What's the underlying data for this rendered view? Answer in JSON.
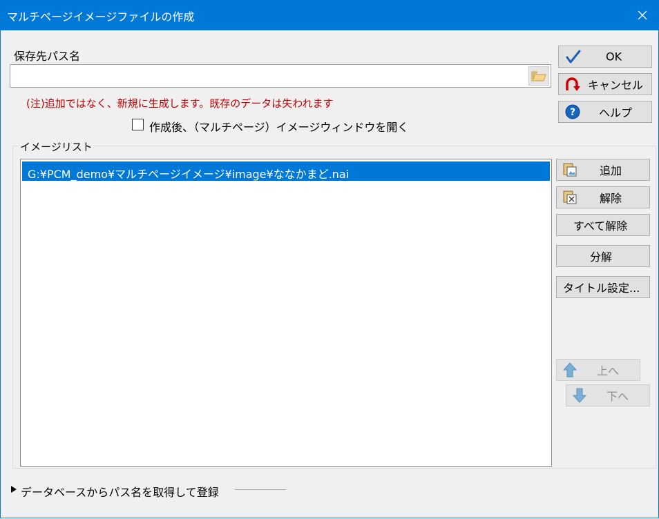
{
  "window": {
    "title": "マルチページイメージファイルの作成",
    "close_icon": "close-icon"
  },
  "path": {
    "label": "保存先パス名",
    "value": "",
    "browse_icon": "folder-open-icon"
  },
  "warning": "(注)追加ではなく、新規に生成します。既存のデータは失われます",
  "open_after": {
    "label": "作成後、（マルチページ）イメージウィンドウを開く",
    "checked": false
  },
  "dialog_buttons": {
    "ok": "OK",
    "cancel": "キャンセル",
    "help": "ヘルプ"
  },
  "image_list": {
    "legend": "イメージリスト",
    "items": [
      "G:¥PCM_demo¥マルチページイメージ¥image¥ななかまど.nai"
    ],
    "selected_index": 0
  },
  "list_buttons": {
    "add": "追加",
    "remove": "解除",
    "remove_all": "すべて解除",
    "split": "分解",
    "title_settings": "タイトル設定...",
    "move_up": "上へ",
    "move_down": "下へ"
  },
  "expander": {
    "label": "データベースからパス名を取得して登録",
    "expanded": false
  },
  "colors": {
    "titlebar": "#0078d7",
    "selection": "#0078d7",
    "warning_text": "#c00000",
    "cancel_icon": "#d00000",
    "help_icon": "#1565c0",
    "arrow_icon": "#7ab0d8"
  }
}
